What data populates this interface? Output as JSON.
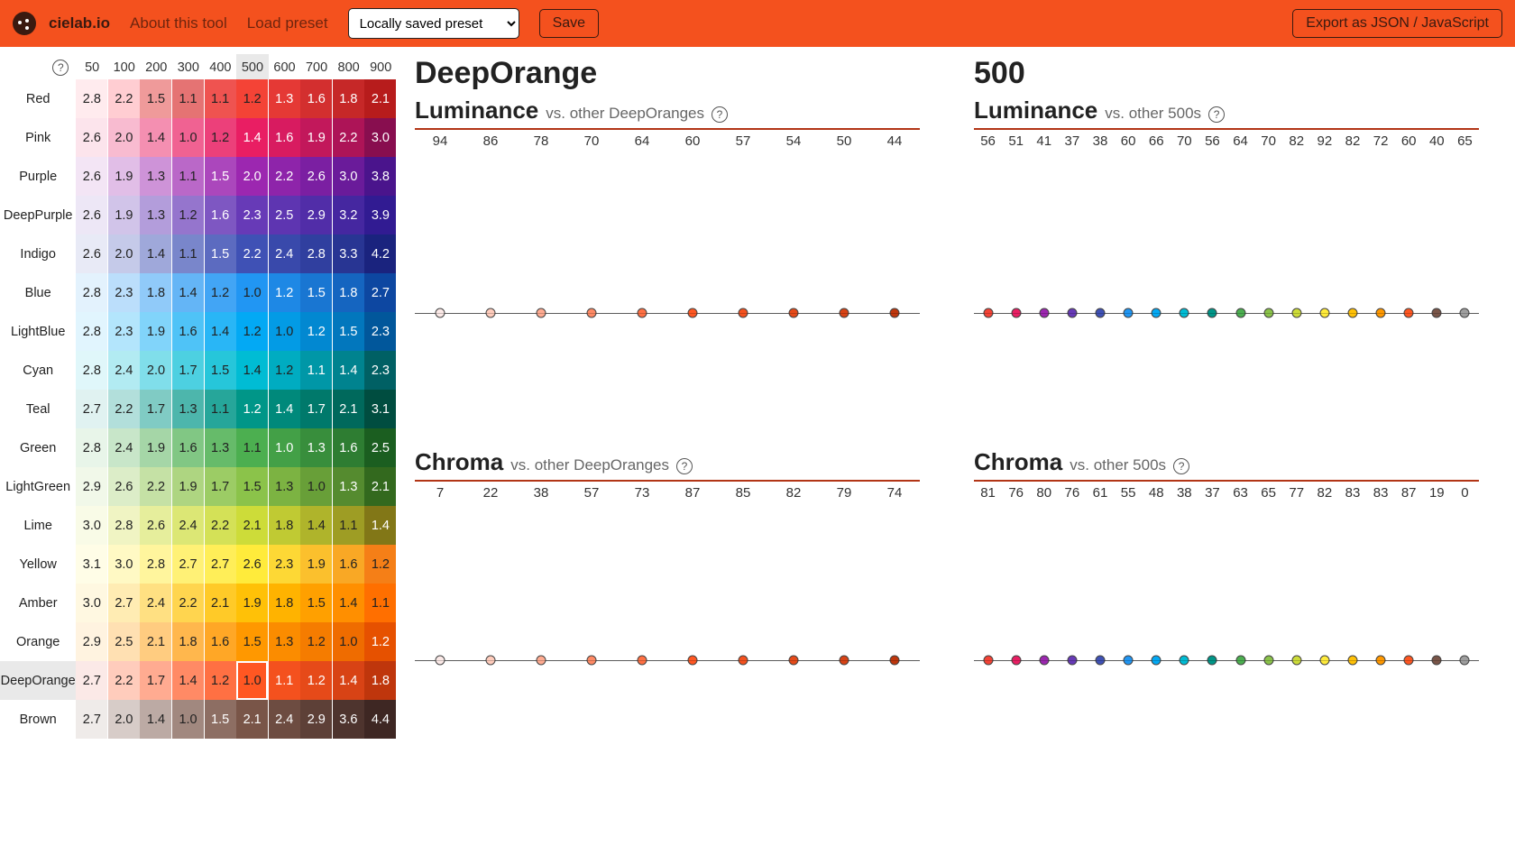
{
  "header": {
    "brand": "cielab.io",
    "about": "About this tool",
    "load": "Load preset",
    "preset_selected": "Locally saved preset",
    "save": "Save",
    "export": "Export as JSON / JavaScript"
  },
  "shades": [
    "50",
    "100",
    "200",
    "300",
    "400",
    "500",
    "600",
    "700",
    "800",
    "900"
  ],
  "selected": {
    "row": "DeepOrange",
    "shade": "500",
    "row_index": 15,
    "col_index": 5
  },
  "rows": [
    {
      "name": "Red",
      "vals": [
        "2.8",
        "2.2",
        "1.5",
        "1.1",
        "1.1",
        "1.2",
        "1.3",
        "1.6",
        "1.8",
        "2.1"
      ],
      "colors": [
        "#FFEBEE",
        "#FFCDD2",
        "#EF9A9A",
        "#E57373",
        "#EF5350",
        "#F44336",
        "#E53935",
        "#D32F2F",
        "#C62828",
        "#B71C1C"
      ],
      "txt": [
        "d",
        "d",
        "d",
        "d",
        "d",
        "d",
        "l",
        "l",
        "l",
        "l"
      ]
    },
    {
      "name": "Pink",
      "vals": [
        "2.6",
        "2.0",
        "1.4",
        "1.0",
        "1.2",
        "1.4",
        "1.6",
        "1.9",
        "2.2",
        "3.0"
      ],
      "colors": [
        "#FCE4EC",
        "#F8BBD0",
        "#F48FB1",
        "#F06292",
        "#EC407A",
        "#E91E63",
        "#D81B60",
        "#C2185B",
        "#AD1457",
        "#880E4F"
      ],
      "txt": [
        "d",
        "d",
        "d",
        "d",
        "d",
        "l",
        "l",
        "l",
        "l",
        "l"
      ]
    },
    {
      "name": "Purple",
      "vals": [
        "2.6",
        "1.9",
        "1.3",
        "1.1",
        "1.5",
        "2.0",
        "2.2",
        "2.6",
        "3.0",
        "3.8"
      ],
      "colors": [
        "#F3E5F5",
        "#E1BEE7",
        "#CE93D8",
        "#BA68C8",
        "#AB47BC",
        "#9C27B0",
        "#8E24AA",
        "#7B1FA2",
        "#6A1B9A",
        "#4A148C"
      ],
      "txt": [
        "d",
        "d",
        "d",
        "d",
        "l",
        "l",
        "l",
        "l",
        "l",
        "l"
      ]
    },
    {
      "name": "DeepPurple",
      "vals": [
        "2.6",
        "1.9",
        "1.3",
        "1.2",
        "1.6",
        "2.3",
        "2.5",
        "2.9",
        "3.2",
        "3.9"
      ],
      "colors": [
        "#EDE7F6",
        "#D1C4E9",
        "#B39DDB",
        "#9575CD",
        "#7E57C2",
        "#673AB7",
        "#5E35B1",
        "#512DA8",
        "#4527A0",
        "#311B92"
      ],
      "txt": [
        "d",
        "d",
        "d",
        "d",
        "l",
        "l",
        "l",
        "l",
        "l",
        "l"
      ]
    },
    {
      "name": "Indigo",
      "vals": [
        "2.6",
        "2.0",
        "1.4",
        "1.1",
        "1.5",
        "2.2",
        "2.4",
        "2.8",
        "3.3",
        "4.2"
      ],
      "colors": [
        "#E8EAF6",
        "#C5CAE9",
        "#9FA8DA",
        "#7986CB",
        "#5C6BC0",
        "#3F51B5",
        "#3949AB",
        "#303F9F",
        "#283593",
        "#1A237E"
      ],
      "txt": [
        "d",
        "d",
        "d",
        "d",
        "l",
        "l",
        "l",
        "l",
        "l",
        "l"
      ]
    },
    {
      "name": "Blue",
      "vals": [
        "2.8",
        "2.3",
        "1.8",
        "1.4",
        "1.2",
        "1.0",
        "1.2",
        "1.5",
        "1.8",
        "2.7"
      ],
      "colors": [
        "#E3F2FD",
        "#BBDEFB",
        "#90CAF9",
        "#64B5F6",
        "#42A5F5",
        "#2196F3",
        "#1E88E5",
        "#1976D2",
        "#1565C0",
        "#0D47A1"
      ],
      "txt": [
        "d",
        "d",
        "d",
        "d",
        "d",
        "d",
        "l",
        "l",
        "l",
        "l"
      ]
    },
    {
      "name": "LightBlue",
      "vals": [
        "2.8",
        "2.3",
        "1.9",
        "1.6",
        "1.4",
        "1.2",
        "1.0",
        "1.2",
        "1.5",
        "2.3"
      ],
      "colors": [
        "#E1F5FE",
        "#B3E5FC",
        "#81D4FA",
        "#4FC3F7",
        "#29B6F6",
        "#03A9F4",
        "#039BE5",
        "#0288D1",
        "#0277BD",
        "#01579B"
      ],
      "txt": [
        "d",
        "d",
        "d",
        "d",
        "d",
        "d",
        "d",
        "l",
        "l",
        "l"
      ]
    },
    {
      "name": "Cyan",
      "vals": [
        "2.8",
        "2.4",
        "2.0",
        "1.7",
        "1.5",
        "1.4",
        "1.2",
        "1.1",
        "1.4",
        "2.3"
      ],
      "colors": [
        "#E0F7FA",
        "#B2EBF2",
        "#80DEEA",
        "#4DD0E1",
        "#26C6DA",
        "#00BCD4",
        "#00ACC1",
        "#0097A7",
        "#00838F",
        "#006064"
      ],
      "txt": [
        "d",
        "d",
        "d",
        "d",
        "d",
        "d",
        "d",
        "l",
        "l",
        "l"
      ]
    },
    {
      "name": "Teal",
      "vals": [
        "2.7",
        "2.2",
        "1.7",
        "1.3",
        "1.1",
        "1.2",
        "1.4",
        "1.7",
        "2.1",
        "3.1"
      ],
      "colors": [
        "#E0F2F1",
        "#B2DFDB",
        "#80CBC4",
        "#4DB6AC",
        "#26A69A",
        "#009688",
        "#00897B",
        "#00796B",
        "#00695C",
        "#004D40"
      ],
      "txt": [
        "d",
        "d",
        "d",
        "d",
        "d",
        "l",
        "l",
        "l",
        "l",
        "l"
      ]
    },
    {
      "name": "Green",
      "vals": [
        "2.8",
        "2.4",
        "1.9",
        "1.6",
        "1.3",
        "1.1",
        "1.0",
        "1.3",
        "1.6",
        "2.5"
      ],
      "colors": [
        "#E8F5E9",
        "#C8E6C9",
        "#A5D6A7",
        "#81C784",
        "#66BB6A",
        "#4CAF50",
        "#43A047",
        "#388E3C",
        "#2E7D32",
        "#1B5E20"
      ],
      "txt": [
        "d",
        "d",
        "d",
        "d",
        "d",
        "d",
        "l",
        "l",
        "l",
        "l"
      ]
    },
    {
      "name": "LightGreen",
      "vals": [
        "2.9",
        "2.6",
        "2.2",
        "1.9",
        "1.7",
        "1.5",
        "1.3",
        "1.0",
        "1.3",
        "2.1"
      ],
      "colors": [
        "#F1F8E9",
        "#DCEDC8",
        "#C5E1A5",
        "#AED581",
        "#9CCC65",
        "#8BC34A",
        "#7CB342",
        "#689F38",
        "#558B2F",
        "#33691E"
      ],
      "txt": [
        "d",
        "d",
        "d",
        "d",
        "d",
        "d",
        "d",
        "d",
        "l",
        "l"
      ]
    },
    {
      "name": "Lime",
      "vals": [
        "3.0",
        "2.8",
        "2.6",
        "2.4",
        "2.2",
        "2.1",
        "1.8",
        "1.4",
        "1.1",
        "1.4"
      ],
      "colors": [
        "#F9FBE7",
        "#F0F4C3",
        "#E6EE9C",
        "#DCE775",
        "#D4E157",
        "#CDDC39",
        "#C0CA33",
        "#AFB42B",
        "#9E9D24",
        "#827717"
      ],
      "txt": [
        "d",
        "d",
        "d",
        "d",
        "d",
        "d",
        "d",
        "d",
        "d",
        "l"
      ]
    },
    {
      "name": "Yellow",
      "vals": [
        "3.1",
        "3.0",
        "2.8",
        "2.7",
        "2.7",
        "2.6",
        "2.3",
        "1.9",
        "1.6",
        "1.2"
      ],
      "colors": [
        "#FFFDE7",
        "#FFF9C4",
        "#FFF59D",
        "#FFF176",
        "#FFEE58",
        "#FFEB3B",
        "#FDD835",
        "#FBC02D",
        "#F9A825",
        "#F57F17"
      ],
      "txt": [
        "d",
        "d",
        "d",
        "d",
        "d",
        "d",
        "d",
        "d",
        "d",
        "d"
      ]
    },
    {
      "name": "Amber",
      "vals": [
        "3.0",
        "2.7",
        "2.4",
        "2.2",
        "2.1",
        "1.9",
        "1.8",
        "1.5",
        "1.4",
        "1.1"
      ],
      "colors": [
        "#FFF8E1",
        "#FFECB3",
        "#FFE082",
        "#FFD54F",
        "#FFCA28",
        "#FFC107",
        "#FFB300",
        "#FFA000",
        "#FF8F00",
        "#FF6F00"
      ],
      "txt": [
        "d",
        "d",
        "d",
        "d",
        "d",
        "d",
        "d",
        "d",
        "d",
        "d"
      ]
    },
    {
      "name": "Orange",
      "vals": [
        "2.9",
        "2.5",
        "2.1",
        "1.8",
        "1.6",
        "1.5",
        "1.3",
        "1.2",
        "1.0",
        "1.2"
      ],
      "colors": [
        "#FFF3E0",
        "#FFE0B2",
        "#FFCC80",
        "#FFB74D",
        "#FFA726",
        "#FF9800",
        "#FB8C00",
        "#F57C00",
        "#EF6C00",
        "#E65100"
      ],
      "txt": [
        "d",
        "d",
        "d",
        "d",
        "d",
        "d",
        "d",
        "d",
        "d",
        "l"
      ]
    },
    {
      "name": "DeepOrange",
      "vals": [
        "2.7",
        "2.2",
        "1.7",
        "1.4",
        "1.2",
        "1.0",
        "1.1",
        "1.2",
        "1.4",
        "1.8"
      ],
      "colors": [
        "#FBE9E7",
        "#FFCCBC",
        "#FFAB91",
        "#FF8A65",
        "#FF7043",
        "#FF5722",
        "#F4511E",
        "#E64A19",
        "#D84315",
        "#BF360C"
      ],
      "txt": [
        "d",
        "d",
        "d",
        "d",
        "d",
        "d",
        "l",
        "l",
        "l",
        "l"
      ]
    },
    {
      "name": "Brown",
      "vals": [
        "2.7",
        "2.0",
        "1.4",
        "1.0",
        "1.5",
        "2.1",
        "2.4",
        "2.9",
        "3.6",
        "4.4"
      ],
      "colors": [
        "#EFEBE9",
        "#D7CCC8",
        "#BCAAA4",
        "#A1887F",
        "#8D6E63",
        "#795548",
        "#6D4C41",
        "#5D4037",
        "#4E342E",
        "#3E2723"
      ],
      "txt": [
        "d",
        "d",
        "d",
        "d",
        "l",
        "l",
        "l",
        "l",
        "l",
        "l"
      ]
    }
  ],
  "titles": {
    "left": "DeepOrange",
    "right": "500",
    "lum": "Luminance",
    "chr": "Chroma",
    "sub_left": "vs. other DeepOranges",
    "sub_right": "vs. other 500s"
  },
  "chart_data": {
    "lum_left": {
      "type": "bar",
      "values": [
        94,
        86,
        78,
        70,
        64,
        60,
        57,
        54,
        50,
        44
      ],
      "colors": [
        "#FBE9E7",
        "#FFCCBC",
        "#FFAB91",
        "#FF8A65",
        "#FF7043",
        "#FF5722",
        "#F4511E",
        "#E64A19",
        "#D84315",
        "#BF360C"
      ],
      "hl": 5,
      "ref": 60
    },
    "chr_left": {
      "type": "bar",
      "values": [
        7,
        22,
        38,
        57,
        73,
        87,
        85,
        82,
        79,
        74
      ],
      "colors": [
        "#FBE9E7",
        "#FFCCBC",
        "#FFAB91",
        "#FF8A65",
        "#FF7043",
        "#FF5722",
        "#F4511E",
        "#E64A19",
        "#D84315",
        "#BF360C"
      ],
      "hl": 5,
      "ref": 87
    },
    "lum_right": {
      "type": "bar",
      "values": [
        56,
        51,
        41,
        37,
        38,
        60,
        66,
        70,
        56,
        64,
        70,
        82,
        92,
        82,
        72,
        60,
        40,
        65
      ],
      "colors": [
        "#F44336",
        "#E91E63",
        "#9C27B0",
        "#673AB7",
        "#3F51B5",
        "#2196F3",
        "#03A9F4",
        "#00BCD4",
        "#009688",
        "#4CAF50",
        "#8BC34A",
        "#CDDC39",
        "#FFEB3B",
        "#FFC107",
        "#FF9800",
        "#FF5722",
        "#795548",
        "#9E9E9E"
      ],
      "hl": 15,
      "ref": 60
    },
    "chr_right": {
      "type": "bar",
      "values": [
        81,
        76,
        80,
        76,
        61,
        55,
        48,
        38,
        37,
        63,
        65,
        77,
        82,
        83,
        83,
        87,
        19,
        0
      ],
      "colors": [
        "#F44336",
        "#E91E63",
        "#9C27B0",
        "#673AB7",
        "#3F51B5",
        "#2196F3",
        "#03A9F4",
        "#00BCD4",
        "#009688",
        "#4CAF50",
        "#8BC34A",
        "#CDDC39",
        "#FFEB3B",
        "#FFC107",
        "#FF9800",
        "#FF5722",
        "#795548",
        "#9E9E9E"
      ],
      "hl": 15,
      "ref": 87
    }
  }
}
